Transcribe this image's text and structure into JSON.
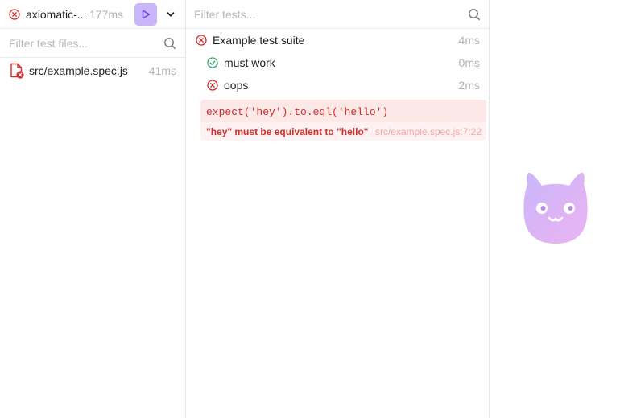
{
  "header": {
    "project_name": "axiomatic-...",
    "duration": "177ms",
    "run_icon": "play-icon",
    "menu_icon": "chevron-down-icon"
  },
  "file_filter": {
    "placeholder": "Filter test files..."
  },
  "files": [
    {
      "name": "src/example.spec.js",
      "duration": "41ms",
      "status": "failed",
      "icon": "file-error-icon"
    }
  ],
  "test_filter": {
    "placeholder": "Filter tests..."
  },
  "tests": {
    "suite": {
      "label": "Example test suite",
      "duration": "4ms",
      "status": "failed"
    },
    "items": [
      {
        "label": "must work",
        "duration": "0ms",
        "status": "passed"
      },
      {
        "label": "oops",
        "duration": "2ms",
        "status": "failed"
      }
    ]
  },
  "error": {
    "code": "expect('hey').to.eql('hello')",
    "message": "\"hey\" must be equivalent to \"hello\"",
    "location": "src/example.spec.js:7:22"
  },
  "colors": {
    "accent": "#c9b6fa",
    "error": "#d12c2c",
    "pass": "#2fa36b",
    "error_bg": "#fde8e8",
    "muted": "#b3b3b3"
  },
  "mascot": {
    "icon": "cat-mascot-icon"
  }
}
